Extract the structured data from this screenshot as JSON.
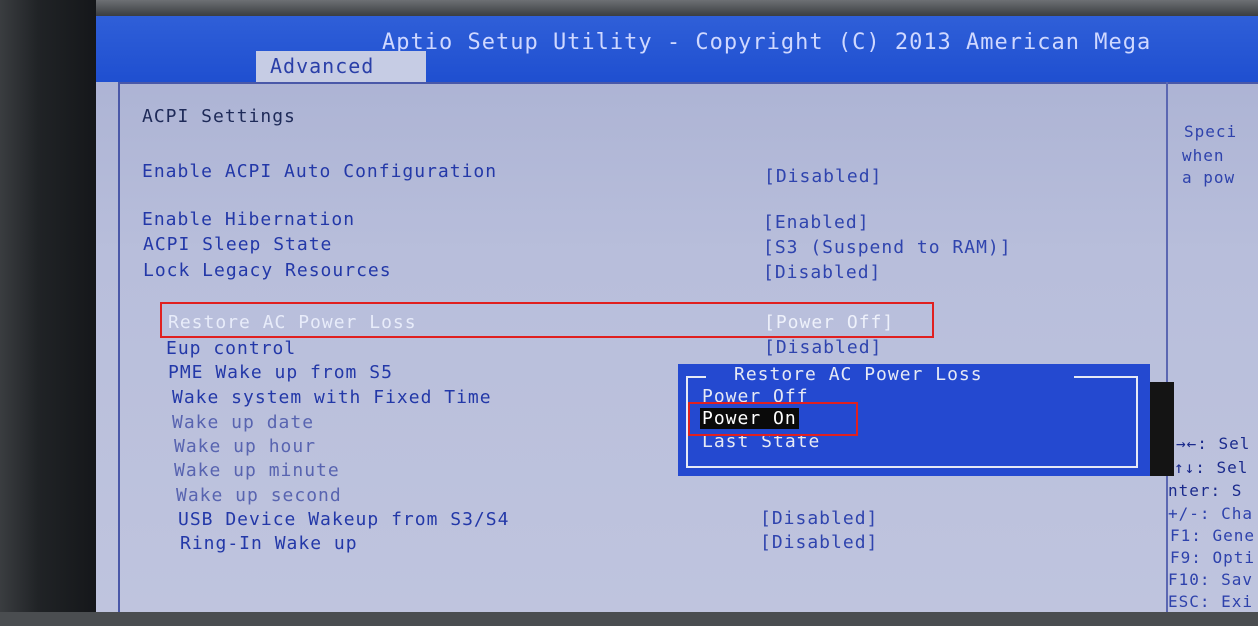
{
  "header": {
    "utility_title": "Aptio Setup Utility - Copyright (C) 2013 American Mega",
    "active_tab": "Advanced"
  },
  "page": {
    "title": "ACPI Settings"
  },
  "settings": [
    {
      "label": "Enable ACPI Auto Configuration",
      "value": "[Disabled]"
    },
    {
      "label": "Enable Hibernation",
      "value": "[Enabled]"
    },
    {
      "label": "ACPI Sleep State",
      "value": "[S3 (Suspend to RAM)]"
    },
    {
      "label": "Lock Legacy Resources",
      "value": "[Disabled]"
    },
    {
      "label": "Restore AC Power Loss",
      "value": "[Power Off]",
      "selected": true
    },
    {
      "label": "Eup control",
      "value": "[Disabled]"
    },
    {
      "label": "PME Wake up from S5",
      "value": ""
    },
    {
      "label": "Wake system with Fixed Time",
      "value": ""
    },
    {
      "label": "Wake up date",
      "value": ""
    },
    {
      "label": "Wake up hour",
      "value": ""
    },
    {
      "label": "Wake up minute",
      "value": ""
    },
    {
      "label": "Wake up second",
      "value": ""
    },
    {
      "label": "USB Device Wakeup from S3/S4",
      "value": "[Disabled]"
    },
    {
      "label": "Ring-In Wake up",
      "value": "[Disabled]"
    }
  ],
  "popup": {
    "title": "Restore AC Power Loss",
    "options": [
      "Power Off",
      "Power On",
      "Last State"
    ],
    "highlighted_index": 1
  },
  "help": {
    "description": [
      "Speci",
      "when",
      "a pow"
    ],
    "keys": [
      "→←: Sel",
      "↑↓: Sel",
      "nter: S",
      "+/-: Cha",
      "F1: Gene",
      "F9: Opti",
      "F10: Sav",
      "ESC: Exi"
    ]
  },
  "colors": {
    "header_bar": "#2f5fd8",
    "screen_bg": "#b8bedb",
    "popup_bg": "#2449d0",
    "annotation_red": "#e02020"
  }
}
